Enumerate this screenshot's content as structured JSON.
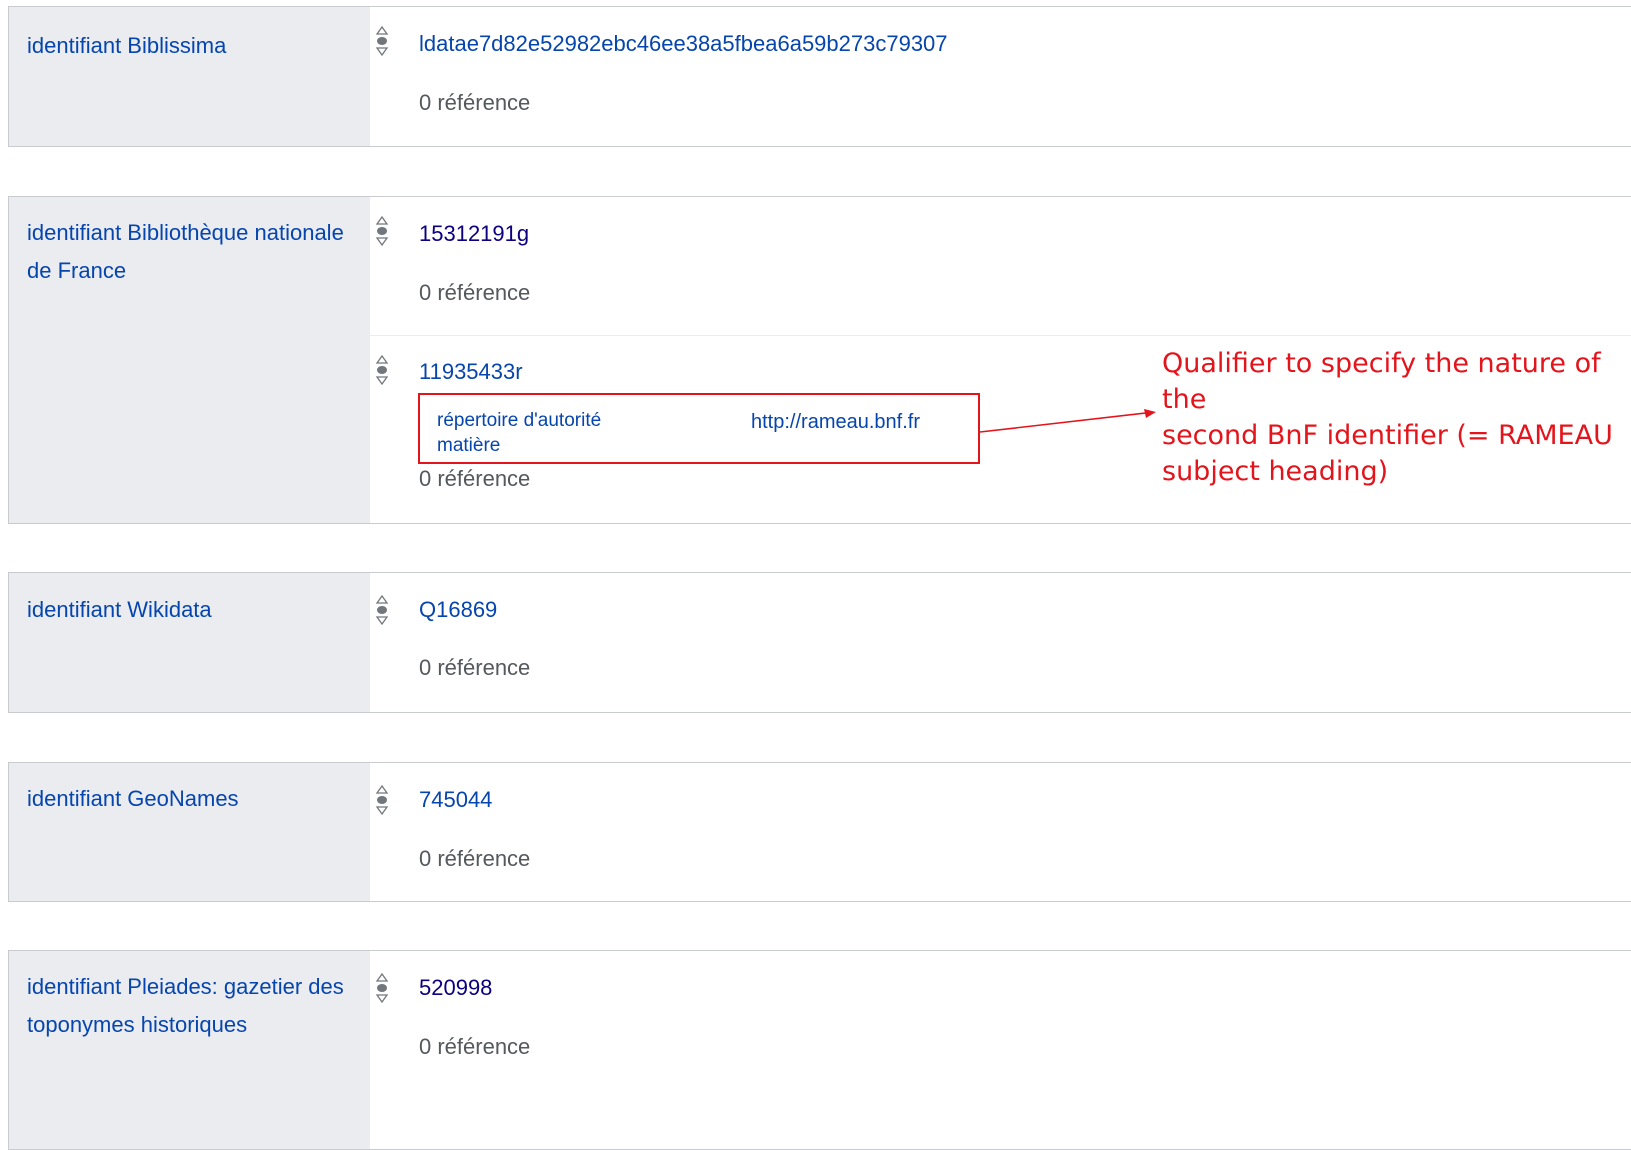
{
  "statements": [
    {
      "property": "identifiant Biblissima",
      "values": [
        {
          "value": "ldatae7d82e52982ebc46ee38a5fbea6a59b273c79307",
          "references": "0 référence"
        }
      ]
    },
    {
      "property": "identifiant Bibliothèque nationale de France",
      "values": [
        {
          "value": "15312191g",
          "references": "0 référence"
        },
        {
          "value": "11935433r",
          "qualifier": {
            "property": "répertoire d'autorité matière",
            "value": "http://rameau.bnf.fr"
          },
          "references": "0 référence"
        }
      ]
    },
    {
      "property": "identifiant Wikidata",
      "values": [
        {
          "value": "Q16869",
          "references": "0 référence"
        }
      ]
    },
    {
      "property": "identifiant GeoNames",
      "values": [
        {
          "value": "745044",
          "references": "0 référence"
        }
      ]
    },
    {
      "property": "identifiant Pleiades: gazetier des toponymes historiques",
      "values": [
        {
          "value": "520998",
          "references": "0 référence"
        }
      ]
    }
  ],
  "annotation": {
    "text": "Qualifier to specify the nature of the\nsecond BnF identifier (= RAMEAU\nsubject heading)"
  },
  "colors": {
    "link": "#0645ad",
    "visited_link": "#0b0080",
    "property_background": "#eaecf0",
    "border": "#c8ccd1",
    "annotation": "#e3141b"
  },
  "icons": {
    "rank": "rank-selector-icon",
    "arrow": "arrow-icon"
  }
}
